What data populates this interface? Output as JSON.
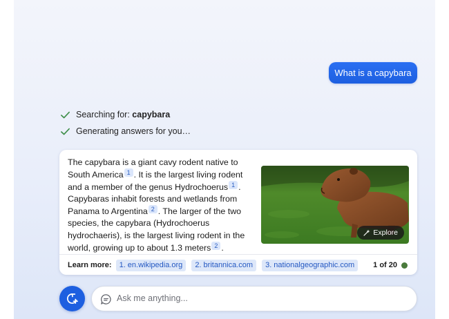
{
  "chat": {
    "user_message": "What is a capybara",
    "status": [
      {
        "prefix": "Searching for: ",
        "query": "capybara"
      },
      {
        "prefix": "Generating answers for you…"
      }
    ],
    "answer": {
      "segments": [
        "The capybara is a giant cavy rodent native to South America",
        ". It is the largest living rodent and a member of the genus Hydrochoerus",
        ". Capybaras inhabit forests and wetlands from Panama to Argentina",
        ". The larger of the two species, the capybara (Hydrochoerus hydrochaeris), is the largest living rodent in the world, growing up to about 1.3 meters",
        "."
      ],
      "citations": [
        "1",
        "1",
        "2",
        "2"
      ],
      "image_alt": "capybara",
      "explore_label": "Explore"
    },
    "learn_more": {
      "label": "Learn more:",
      "links": [
        "1. en.wikipedia.org",
        "2. britannica.com",
        "3. nationalgeographic.com"
      ],
      "page_counter": "1 of 20"
    },
    "input": {
      "placeholder": "Ask me anything..."
    }
  },
  "colors": {
    "accent": "#1d5fe0",
    "check": "#3f8f4a",
    "citation_bg": "#dbe6fb",
    "counter_dot": "#4a7a3c"
  },
  "icons": {
    "status": "checkmark-icon",
    "explore": "sparkle-wand-icon",
    "new_topic": "new-topic-icon",
    "input": "chat-bubble-icon"
  }
}
